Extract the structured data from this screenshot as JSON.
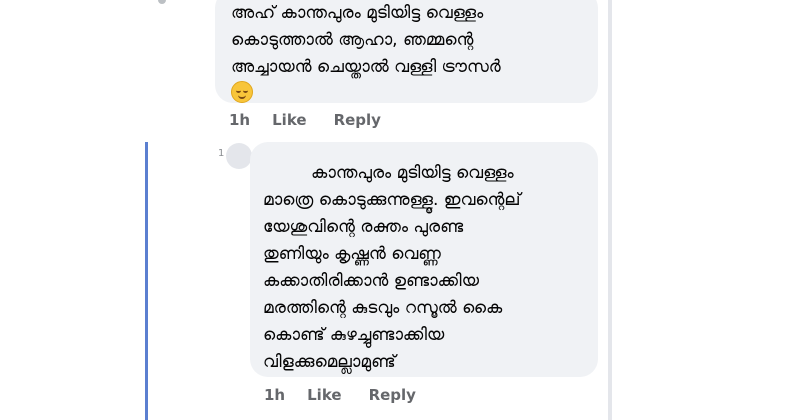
{
  "comment1": {
    "lines": [
      "അഹ് കാന്തപുരം മുടിയിട്ട വെള്ളം",
      "കൊടുത്താൽ ആഹാ, ഞമ്മന്റെ",
      "അച്ചായൻ ചെയ്താൽ വള്ളി ട്രൗസർ"
    ],
    "emoji": "relieved-face-emoji",
    "time": "1h",
    "like_label": "Like",
    "reply_label": "Reply"
  },
  "reply1": {
    "avatar_stub": "1",
    "lines": [
      "കാന്തപുരം മുടിയിട്ട വെള്ളം",
      "മാത്രെ കൊടുക്കുന്നുള്ളൂ. ഇവന്റെല്",
      "യേശുവിന്റെ രക്തം പുരണ്ട",
      "തുണിയും കൃഷ്ണൻ വെണ്ണ",
      "കക്കാതിരിക്കാൻ ഉണ്ടാക്കിയ",
      "മരത്തിന്റെ കുടവും റസൂൽ കൈ",
      "കൊണ്ട് കുഴച്ചുണ്ടാക്കിയ",
      "വിളക്കുമെല്ലാമുണ്ട്"
    ],
    "time": "1h",
    "like_label": "Like",
    "reply_label": "Reply"
  },
  "colors": {
    "bubble_bg": "#f0f2f5",
    "thread_line": "#5b7fd0",
    "meta_text": "#65676b"
  }
}
